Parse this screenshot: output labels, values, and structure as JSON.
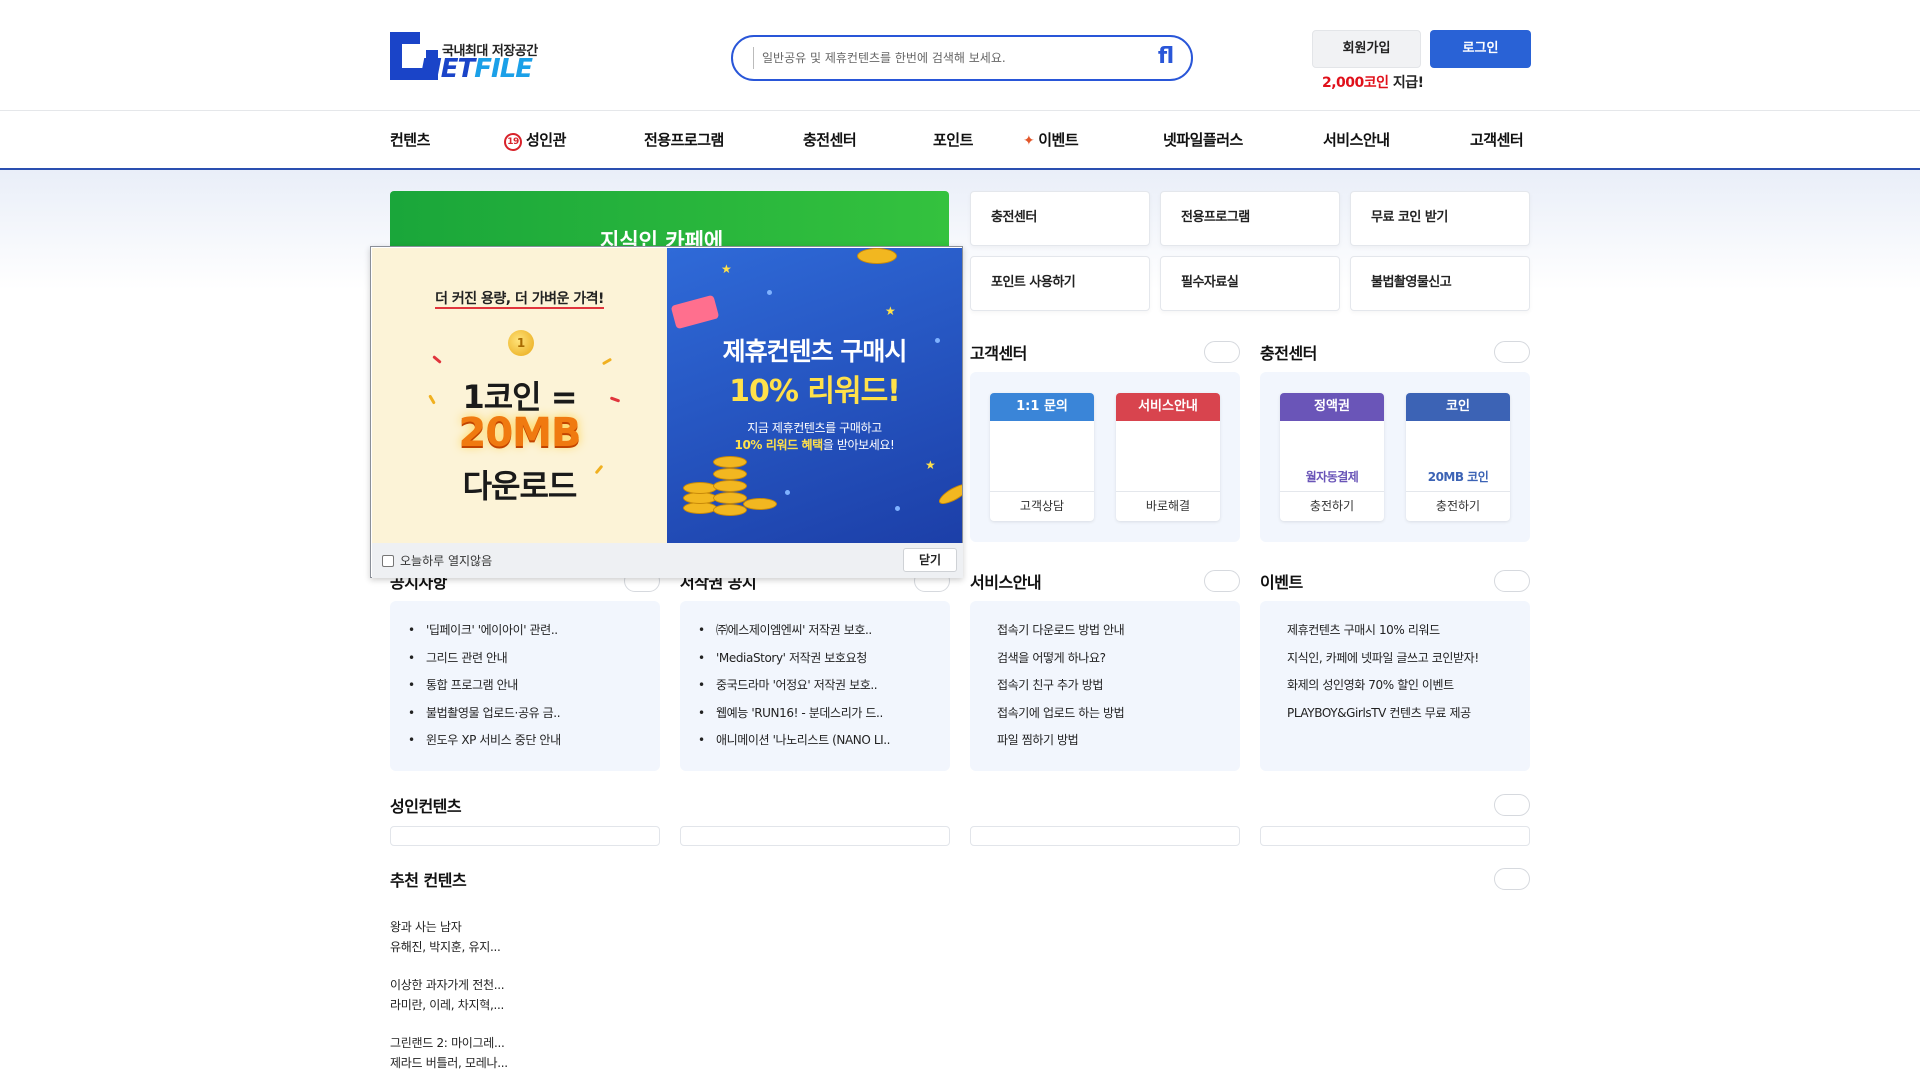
{
  "header": {
    "logo_sub": "국내최대 저장공간",
    "logo_main_1": "NET",
    "logo_main_2": "FILE",
    "search_placeholder": "일반공유 및 제휴컨텐츠를 한번에 검색해 보세요.",
    "join_label": "회원가입",
    "login_label": "로그인",
    "coin_amount": "2,000코인",
    "coin_suffix": " 지급!"
  },
  "nav": {
    "items": [
      "컨텐츠",
      "성인관",
      "전용프로그램",
      "충전센터",
      "포인트",
      "이벤트",
      "넷파일플러스",
      "서비스안내",
      "고객센터"
    ],
    "badge19": "19"
  },
  "banner": {
    "title": "지식인 카페에"
  },
  "quick_links": [
    "충전센터",
    "전용프로그램",
    "무료 코인 받기",
    "포인트 사용하기",
    "필수자료실",
    "불법촬영물신고"
  ],
  "customer_center": {
    "title": "고객센터",
    "cards": [
      {
        "head": "1:1 문의",
        "foot": "고객상담",
        "color": "#3a85d8"
      },
      {
        "head": "서비스안내",
        "foot": "바로해결",
        "color": "#d8444e"
      }
    ]
  },
  "charge_center": {
    "title": "충전센터",
    "cards": [
      {
        "head": "정액권",
        "note": "월자동결제",
        "foot": "충전하기",
        "color": "#6a55b8"
      },
      {
        "head": "코인",
        "note": "20MB 코인",
        "foot": "충전하기",
        "color": "#3c63b5"
      }
    ]
  },
  "notice": {
    "title": "공지사항",
    "items": [
      "'딥페이크' '에이아이' 관련..",
      "그리드 관련 안내",
      "통합 프로그램 안내",
      "불법촬영물 업로드·공유 금..",
      "윈도우 XP 서비스 중단 안내"
    ]
  },
  "copyright": {
    "title": "저작권 공지",
    "items": [
      "㈜에스제이엠엔씨' 저작권 보호..",
      "'MediaStory' 저작권 보호요청",
      "중국드라마 '어정요' 저작권 보호..",
      "웹예능 'RUN16! - 분데스리가 드..",
      "애니메이션 '나노리스트 (NANO LI.."
    ]
  },
  "service_guide": {
    "title": "서비스안내",
    "items": [
      "접속기 다운로드 방법 안내",
      "검색을 어떻게 하나요?",
      "접속기 친구 추가 방법",
      "접속기에 업로드 하는 방법",
      "파일 찜하기 방법"
    ]
  },
  "event": {
    "title": "이벤트",
    "items": [
      "제휴컨텐츠 구매시 10% 리워드",
      "지식인, 카페에 넷파일 글쓰고 코인받자!",
      "화제의 성인영화 70% 할인 이벤트",
      "PLAYBOY&GirlsTV 컨텐츠 무료 제공"
    ]
  },
  "adult": {
    "title": "성인컨텐츠"
  },
  "recommend": {
    "title": "추천 컨텐츠",
    "items": [
      {
        "name": "왕과 사는 남자",
        "cast": "유해진, 박지훈, 유지..."
      },
      {
        "name": "이상한 과자가게 전천...",
        "cast": "라미란, 이레, 차지혁,..."
      },
      {
        "name": "그린랜드 2: 마이그레...",
        "cast": "제라드 버틀러, 모레나..."
      }
    ]
  },
  "popup": {
    "left": {
      "tag": "더 커진 용량, 더 가벼운 가격!",
      "coin_mark": "1",
      "line1": "1코인 =",
      "line2": "20MB",
      "line3": "다운로드"
    },
    "right": {
      "title1": "제휴컨텐츠 구매시",
      "title2": "10% 리워드!",
      "sub1": "지금 제휴컨텐츠를 구매하고",
      "sub2_highlight": "10% 리워드 혜택",
      "sub2_rest": "을 받아보세요!"
    },
    "checkbox_label": "오늘하루 열지않음",
    "close_label": "닫기"
  },
  "colors": {
    "primary": "#2962d6",
    "accent_red": "#e0101a",
    "nav_line": "#2a4fb0"
  }
}
